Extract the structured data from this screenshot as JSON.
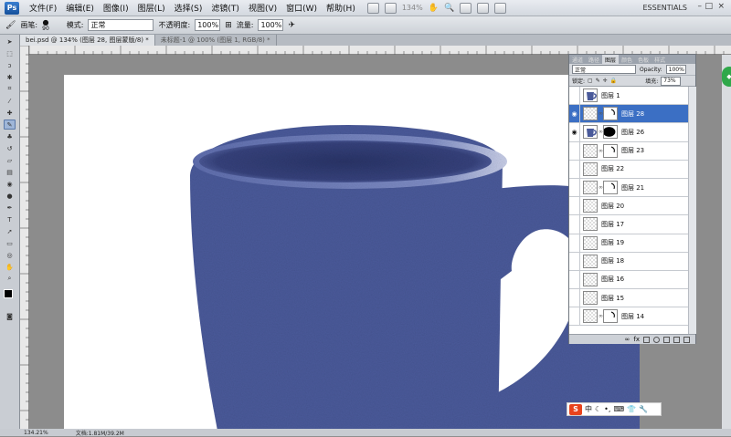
{
  "menubar": {
    "logo": "Ps",
    "items": [
      "文件(F)",
      "编辑(E)",
      "图像(I)",
      "图层(L)",
      "选择(S)",
      "滤镜(T)",
      "视图(V)",
      "窗口(W)",
      "帮助(H)"
    ],
    "zoom": "134%",
    "workspace": "ESSENTIALS",
    "win_controls": [
      "–",
      "□",
      "×"
    ]
  },
  "options_bar": {
    "brush_label": "画笔:",
    "brush_size": "90",
    "mode_label": "模式:",
    "mode_value": "正常",
    "opacity_label": "不透明度:",
    "opacity_value": "100%",
    "flow_label": "流量:",
    "flow_value": "100%"
  },
  "doc_tabs": [
    {
      "label": "bei.psd @ 134% (图层 28, 图层蒙版/8) *",
      "active": true
    },
    {
      "label": "未标题-1 @ 100% (图层 1, RGB/8) *",
      "active": false
    }
  ],
  "panel": {
    "tabs": [
      "通道",
      "路径",
      "图层",
      "颜色",
      "色板",
      "样式"
    ],
    "active_tab": "图层",
    "blend_mode": "正常",
    "opacity_label": "Opacity:",
    "opacity_value": "100%",
    "lock_label": "锁定:",
    "fill_label": "填充:",
    "fill_value": "73%",
    "layers": [
      {
        "name": "图层 1",
        "visible": false,
        "mask": false,
        "selected": false,
        "thumb": "cup"
      },
      {
        "name": "图层 28",
        "visible": true,
        "mask": true,
        "selected": true,
        "thumb": "checker"
      },
      {
        "name": "图层 26",
        "visible": true,
        "mask": true,
        "selected": false,
        "thumb": "cup"
      },
      {
        "name": "图层 23",
        "visible": false,
        "mask": true,
        "selected": false,
        "thumb": "checker"
      },
      {
        "name": "图层 22",
        "visible": false,
        "mask": false,
        "selected": false,
        "thumb": "checker"
      },
      {
        "name": "图层 21",
        "visible": false,
        "mask": true,
        "selected": false,
        "thumb": "checker"
      },
      {
        "name": "图层 20",
        "visible": false,
        "mask": false,
        "selected": false,
        "thumb": "checker"
      },
      {
        "name": "图层 17",
        "visible": false,
        "mask": false,
        "selected": false,
        "thumb": "checker"
      },
      {
        "name": "图层 19",
        "visible": false,
        "mask": false,
        "selected": false,
        "thumb": "checker"
      },
      {
        "name": "图层 18",
        "visible": false,
        "mask": false,
        "selected": false,
        "thumb": "checker"
      },
      {
        "name": "图层 16",
        "visible": false,
        "mask": false,
        "selected": false,
        "thumb": "checker"
      },
      {
        "name": "图层 15",
        "visible": false,
        "mask": false,
        "selected": false,
        "thumb": "checker"
      },
      {
        "name": "图层 14",
        "visible": false,
        "mask": true,
        "selected": false,
        "thumb": "checker"
      }
    ]
  },
  "status": {
    "zoom": "134.21%",
    "doc_info": "文档:1.81M/39.2M"
  },
  "ime": {
    "logo": "S",
    "mode": "中"
  },
  "colors": {
    "cup_blue": "#4a5a9a",
    "selected_layer": "#3b6fc4"
  }
}
